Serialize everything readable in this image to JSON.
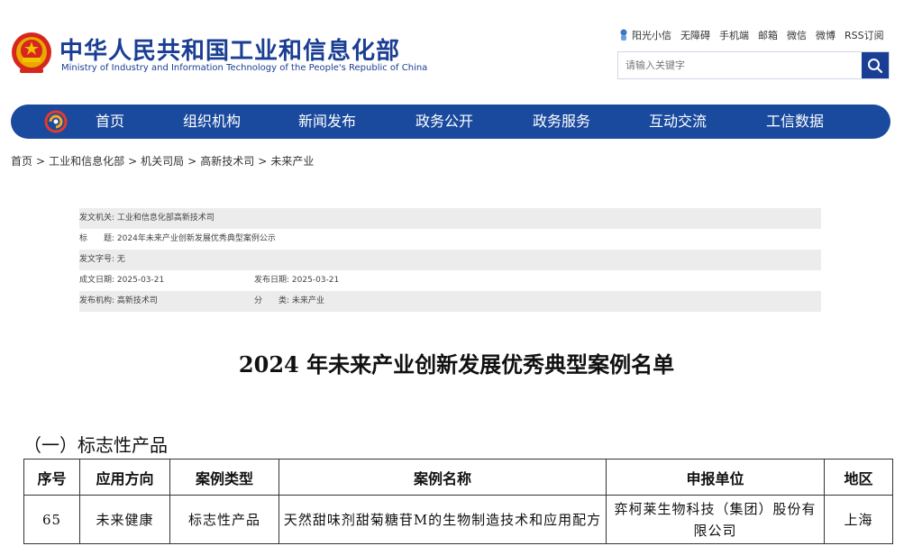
{
  "header": {
    "title": "中华人民共和国工业和信息化部",
    "subtitle": "Ministry of Industry and Information Technology of the People's Republic of China",
    "top_links": [
      "阳光小信",
      "无障碍",
      "手机端",
      "邮箱",
      "微信",
      "微博",
      "RSS订阅"
    ],
    "search_placeholder": "请输入关键字"
  },
  "nav": {
    "items": [
      "首页",
      "组织机构",
      "新闻发布",
      "政务公开",
      "政务服务",
      "互动交流",
      "工信数据"
    ]
  },
  "breadcrumb": [
    "首页",
    "工业和信息化部",
    "机关司局",
    "高新技术司",
    "未来产业"
  ],
  "meta": {
    "issuer_label": "发文机关:",
    "issuer": "工业和信息化部高新技术司",
    "title_label": "标　　题:",
    "title": "2024年未来产业创新发展优秀典型案例公示",
    "docno_label": "发文字号:",
    "docno": "无",
    "date_label": "成文日期:",
    "date": "2025-03-21",
    "pubdate_label": "发布日期:",
    "pubdate": "2025-03-21",
    "org_label": "发布机构:",
    "org": "高新技术司",
    "category_label": "分　　类:",
    "category": "未来产业"
  },
  "document": {
    "title": "2024 年未来产业创新发展优秀典型案例名单",
    "section": "（一）标志性产品"
  },
  "table": {
    "headers": [
      "序号",
      "应用方向",
      "案例类型",
      "案例名称",
      "申报单位",
      "地区"
    ],
    "rows": [
      [
        "65",
        "未来健康",
        "标志性产品",
        "天然甜味剂甜菊糖苷M的生物制造技术和应用配方",
        "弈柯莱生物科技（集团）股份有限公司",
        "上海"
      ]
    ]
  },
  "colors": {
    "brand_blue": "#1a3e93",
    "nav_blue": "#1a4a9e",
    "meta_shade": "#ececec"
  }
}
